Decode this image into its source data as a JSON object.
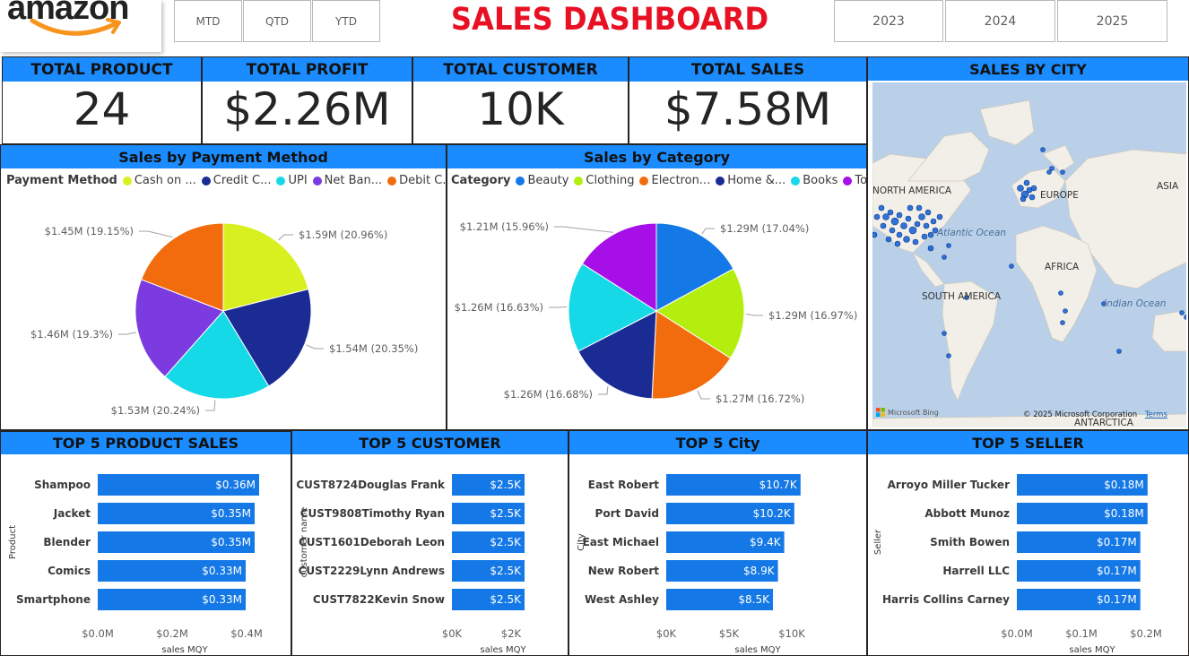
{
  "header": {
    "logo": "amazon",
    "title": "SALES DASHBOARD",
    "period_buttons": [
      "MTD",
      "QTD",
      "YTD"
    ],
    "year_buttons": [
      "2023",
      "2024",
      "2025"
    ]
  },
  "kpis": [
    {
      "label": "TOTAL PRODUCT",
      "value": "24"
    },
    {
      "label": "TOTAL PROFIT",
      "value": "$2.26M"
    },
    {
      "label": "TOTAL CUSTOMER",
      "value": "10K"
    },
    {
      "label": "TOTAL SALES",
      "value": "$7.58M"
    }
  ],
  "payment": {
    "title": "Sales by Payment Method",
    "legend_title": "Payment Method",
    "legend": [
      "Cash on ...",
      "Credit C...",
      "UPI",
      "Net Ban...",
      "Debit C..."
    ],
    "labels": [
      "$1.59M (20.96%)",
      "$1.54M (20.35%)",
      "$1.53M (20.24%)",
      "$1.46M (19.3%)",
      "$1.45M (19.15%)"
    ]
  },
  "category": {
    "title": "Sales by Category",
    "legend_title": "Category",
    "legend": [
      "Beauty",
      "Clothing",
      "Electron...",
      "Home &...",
      "Books",
      "Toys"
    ],
    "labels": [
      "$1.29M (17.04%)",
      "$1.29M (16.97%)",
      "$1.27M (16.72%)",
      "$1.26M (16.68%)",
      "$1.26M (16.63%)",
      "$1.21M (15.96%)"
    ]
  },
  "map": {
    "title": "SALES BY CITY",
    "labels": [
      "NORTH AMERICA",
      "EUROPE",
      "ASIA",
      "AFRICA",
      "SOUTH AMERICA",
      "ANTARCTICA"
    ],
    "oceans": [
      "Atlantic Ocean",
      "Indian Ocean"
    ],
    "bing": "Microsoft Bing",
    "copyright": "© 2025 Microsoft Corporation",
    "terms": "Terms"
  },
  "chart_data": [
    {
      "type": "pie",
      "title": "Sales by Payment Method",
      "legend_title": "Payment Method",
      "categories": [
        "Cash on ...",
        "Debit C...",
        "Net Ban...",
        "UPI",
        "Credit C..."
      ],
      "values": [
        1.59,
        1.54,
        1.53,
        1.46,
        1.45
      ],
      "slice_order_clockwise": [
        "Cash on ...",
        "Credit C...",
        "UPI",
        "Net Ban...",
        "Debit C..."
      ],
      "slice_values": [
        1.59,
        1.54,
        1.53,
        1.46,
        1.45
      ],
      "slice_percent": [
        20.96,
        20.35,
        20.24,
        19.3,
        19.15
      ],
      "colors": [
        "#d9f020",
        "#1a2b94",
        "#16d9e8",
        "#7b3be0",
        "#f26b0c"
      ]
    },
    {
      "type": "pie",
      "title": "Sales by Category",
      "legend_title": "Category",
      "slice_order_clockwise": [
        "Beauty",
        "Clothing",
        "Electron...",
        "Home &...",
        "Books",
        "Toys"
      ],
      "slice_values": [
        1.29,
        1.29,
        1.27,
        1.26,
        1.26,
        1.21
      ],
      "slice_percent": [
        17.04,
        16.97,
        16.72,
        16.68,
        16.63,
        15.96
      ],
      "colors": [
        "#1478e6",
        "#b4ee0e",
        "#f26b0c",
        "#1a2b94",
        "#16d9e8",
        "#a60fe8"
      ]
    },
    {
      "type": "bar",
      "title": "TOP 5 PRODUCT SALES",
      "categories": [
        "Shampoo",
        "Jacket",
        "Blender",
        "Comics",
        "Smartphone"
      ],
      "values": [
        0.36,
        0.35,
        0.35,
        0.33,
        0.33
      ],
      "data_labels": [
        "$0.36M",
        "$0.35M",
        "$0.35M",
        "$0.33M",
        "$0.33M"
      ],
      "xlabel": "sales MQY",
      "ylabel": "Product",
      "ticks": [
        "$0.0M",
        "$0.2M",
        "$0.4M"
      ],
      "xlim": [
        0,
        0.4
      ]
    },
    {
      "type": "bar",
      "title": "TOP 5 CUSTOMER",
      "categories": [
        "CUST8724Douglas Frank",
        "CUST9808Timothy Ryan",
        "CUST1601Deborah Leon",
        "CUST2229Lynn Andrews",
        "CUST7822Kevin Snow"
      ],
      "values": [
        2.5,
        2.5,
        2.5,
        2.5,
        2.5
      ],
      "data_labels": [
        "$2.5K",
        "$2.5K",
        "$2.5K",
        "$2.5K",
        "$2.5K"
      ],
      "xlabel": "sales MQY",
      "ylabel": "customer name",
      "ticks": [
        "$0K",
        "$2K"
      ],
      "xlim": [
        0,
        2
      ]
    },
    {
      "type": "bar",
      "title": "TOP 5 City",
      "categories": [
        "East Robert",
        "Port David",
        "East Michael",
        "New Robert",
        "West Ashley"
      ],
      "values": [
        10.7,
        10.2,
        9.4,
        8.9,
        8.5
      ],
      "data_labels": [
        "$10.7K",
        "$10.2K",
        "$9.4K",
        "$8.9K",
        "$8.5K"
      ],
      "xlabel": "sales MQY",
      "ylabel": "City",
      "ticks": [
        "$0K",
        "$5K",
        "$10K"
      ],
      "xlim": [
        0,
        10
      ]
    },
    {
      "type": "bar",
      "title": "TOP 5 SELLER",
      "categories": [
        "Arroyo Miller Tucker",
        "Abbott Munoz",
        "Smith Bowen",
        "Harrell LLC",
        "Harris Collins Carney"
      ],
      "values": [
        0.18,
        0.18,
        0.17,
        0.17,
        0.17
      ],
      "data_labels": [
        "$0.18M",
        "$0.18M",
        "$0.17M",
        "$0.17M",
        "$0.17M"
      ],
      "xlabel": "sales MQY",
      "ylabel": "Seller",
      "ticks": [
        "$0.0M",
        "$0.1M",
        "$0.2M"
      ],
      "xlim": [
        0,
        0.2
      ]
    }
  ]
}
